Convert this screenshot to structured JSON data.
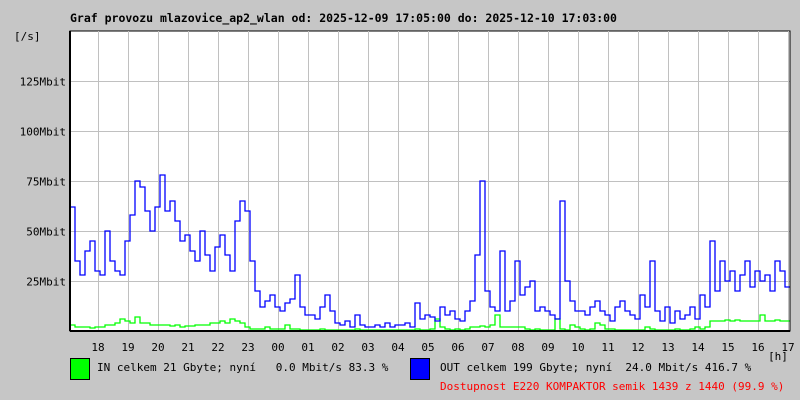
{
  "chart_data": {
    "type": "line",
    "title": "Graf provozu mlazovice_ap2_wlan od: 2025-12-09 17:05:00 do: 2025-12-10 17:03:00",
    "ylabel": "[/s]",
    "xlabel": "[h]",
    "ylim": [
      0,
      150
    ],
    "yticks": [
      {
        "value": 25,
        "label": "25Mbit"
      },
      {
        "value": 50,
        "label": "50Mbit"
      },
      {
        "value": 75,
        "label": "75Mbit"
      },
      {
        "value": 100,
        "label": "100Mbit"
      },
      {
        "value": 125,
        "label": "125Mbit"
      }
    ],
    "xticks": [
      "18",
      "19",
      "20",
      "21",
      "22",
      "23",
      "00",
      "01",
      "02",
      "03",
      "04",
      "05",
      "06",
      "07",
      "08",
      "09",
      "10",
      "11",
      "12",
      "13",
      "14",
      "15",
      "16",
      "17"
    ],
    "grid": true,
    "sample_interval_minutes": 10,
    "series": [
      {
        "name": "IN",
        "color": "#00ff00",
        "unit": "Mbit/s",
        "values": [
          3,
          2,
          2,
          2,
          1.5,
          2,
          2,
          3,
          3,
          4,
          6,
          5,
          4,
          7,
          4,
          4,
          3,
          3,
          3,
          3,
          2.5,
          3,
          2,
          2.5,
          2.5,
          3,
          3,
          3,
          4,
          4,
          5,
          4,
          6,
          5,
          4,
          2,
          1,
          1,
          1,
          2,
          1,
          1,
          1,
          3,
          1,
          1,
          0.5,
          0.5,
          0.5,
          0.5,
          1,
          0.5,
          0.5,
          0.5,
          0.5,
          0.5,
          0.5,
          1,
          0.5,
          0.5,
          0.5,
          0.5,
          0.5,
          0.5,
          0.5,
          0.5,
          0.5,
          0.5,
          0.5,
          1,
          0.5,
          0.5,
          1,
          6,
          2,
          1,
          0.5,
          1,
          0.5,
          1,
          2,
          2,
          2.5,
          2,
          3,
          8,
          2,
          2,
          2,
          2,
          2,
          1,
          0.5,
          1,
          0.5,
          0.5,
          0.5,
          6,
          1,
          0.5,
          3,
          2,
          1,
          0.5,
          1,
          4,
          3,
          1,
          1,
          0.5,
          0.5,
          0.5,
          0.5,
          0.5,
          0.5,
          2,
          1,
          0.5,
          0.5,
          0.5,
          0.5,
          1,
          0.5,
          0.5,
          1,
          2,
          1,
          2,
          5,
          5,
          5,
          5.5,
          5,
          5.5,
          5,
          5,
          5,
          5,
          8,
          5,
          5,
          5.5,
          5,
          5
        ]
      },
      {
        "name": "OUT",
        "color": "#0000ff",
        "unit": "Mbit/s",
        "values": [
          62,
          35,
          28,
          40,
          45,
          30,
          28,
          50,
          35,
          30,
          28,
          45,
          58,
          75,
          72,
          60,
          50,
          62,
          78,
          60,
          65,
          55,
          45,
          48,
          40,
          35,
          50,
          38,
          30,
          42,
          48,
          38,
          30,
          55,
          65,
          60,
          35,
          20,
          12,
          15,
          18,
          12,
          10,
          14,
          16,
          28,
          12,
          8,
          8,
          6,
          12,
          18,
          10,
          4,
          3,
          5,
          2,
          8,
          3,
          2,
          2,
          3,
          2,
          4,
          2,
          3,
          3,
          4,
          2,
          14,
          6,
          8,
          7,
          5,
          12,
          8,
          10,
          6,
          5,
          10,
          15,
          38,
          75,
          20,
          12,
          10,
          40,
          10,
          15,
          35,
          18,
          22,
          25,
          10,
          12,
          10,
          8,
          6,
          65,
          25,
          15,
          10,
          10,
          8,
          12,
          15,
          10,
          8,
          5,
          12,
          15,
          10,
          8,
          6,
          18,
          12,
          35,
          10,
          5,
          12,
          4,
          10,
          6,
          8,
          12,
          6,
          18,
          12,
          45,
          20,
          35,
          25,
          30,
          20,
          28,
          35,
          22,
          30,
          25,
          28,
          20,
          35,
          30,
          22
        ]
      }
    ]
  },
  "legend": {
    "in_text": "IN celkem 21 Gbyte; nyní   0.0 Mbit/s 83.3 %",
    "out_text": "OUT celkem 199 Gbyte; nyní  24.0 Mbit/s 416.7 %",
    "availability": "Dostupnost E220 KOMPAKTOR semik 1439 z 1440 (99.9 %)"
  }
}
